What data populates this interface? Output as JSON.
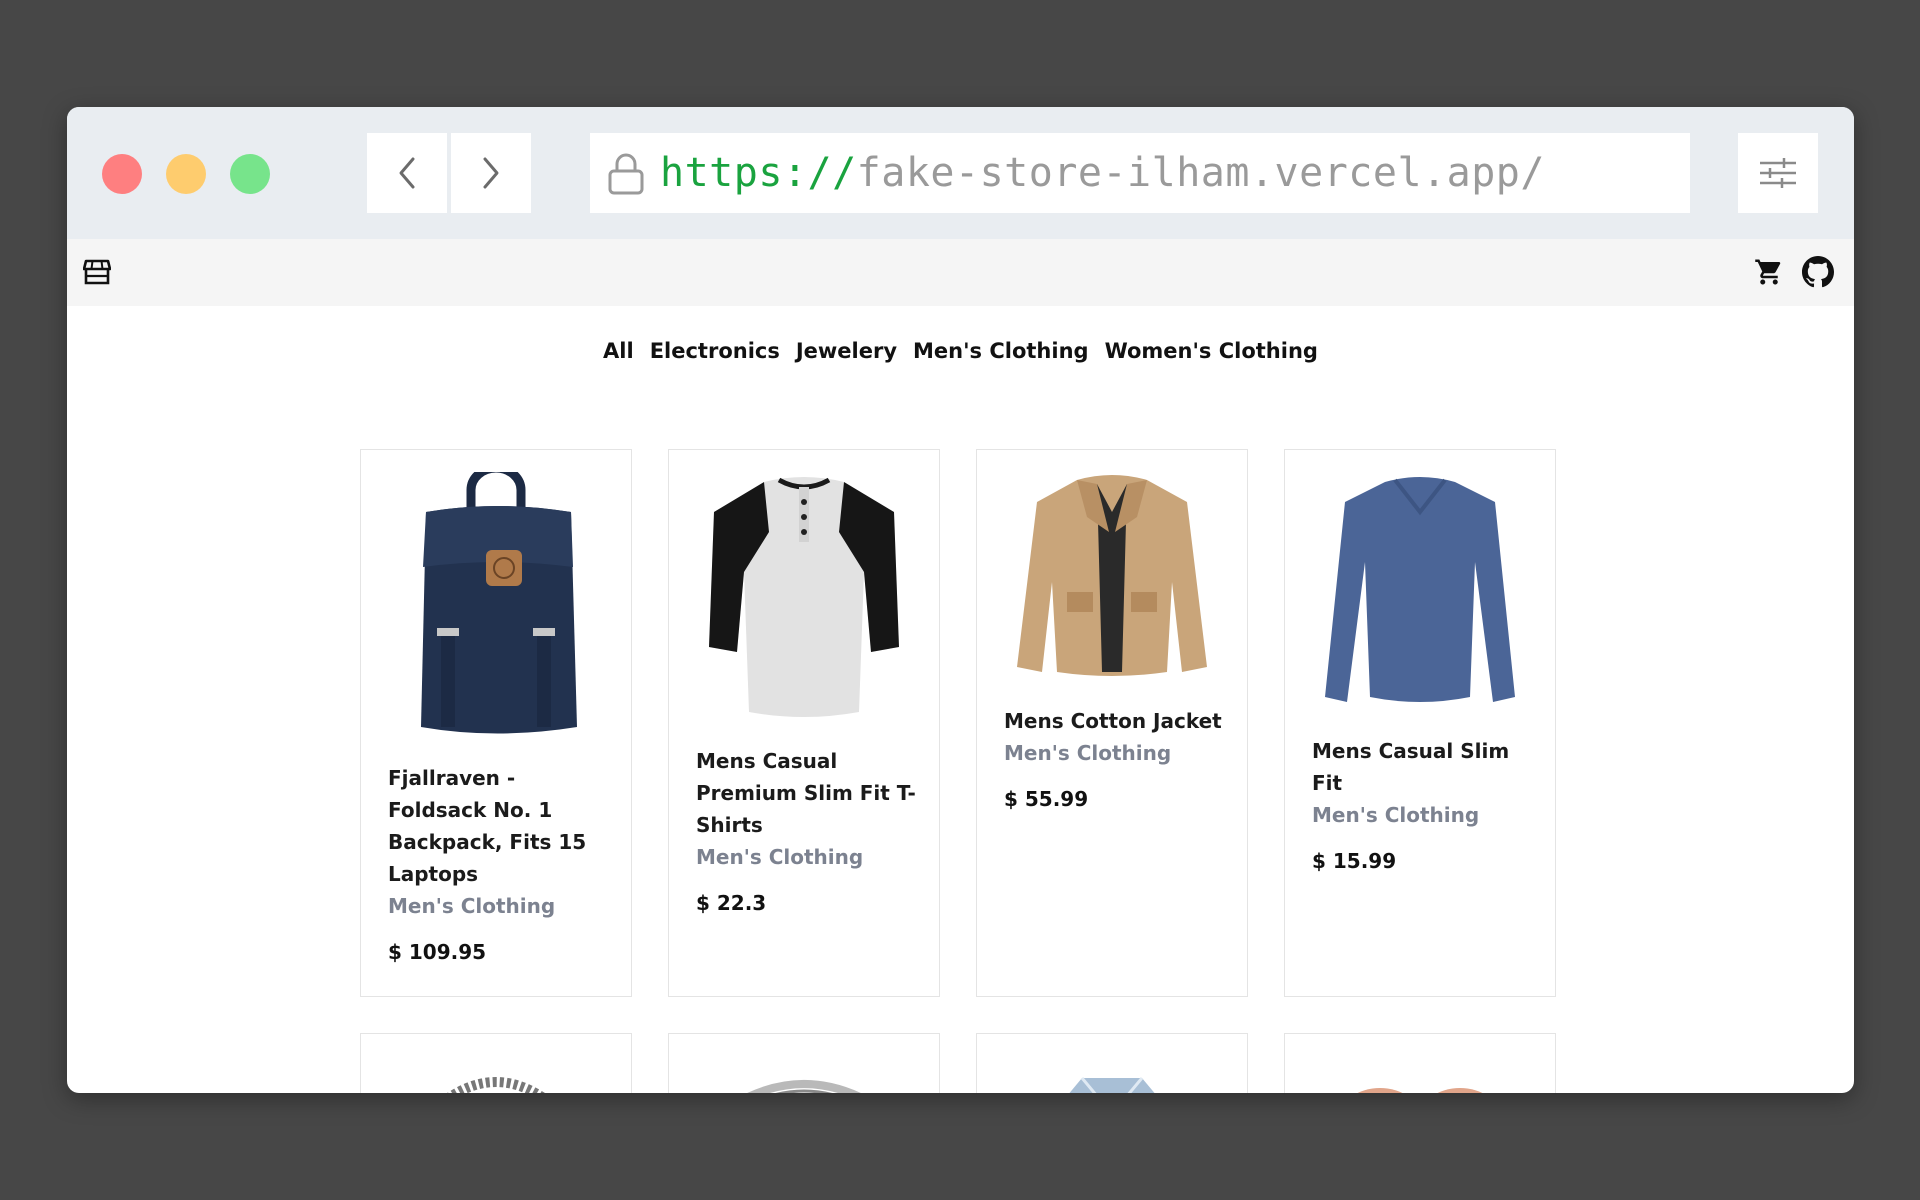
{
  "browser": {
    "url_scheme": "https://",
    "url_host": "fake-store-ilham.vercel.app/"
  },
  "app": {
    "icons": [
      "store-icon",
      "cart-icon",
      "github-icon"
    ]
  },
  "categories": [
    "All",
    "Electronics",
    "Jewelery",
    "Men's Clothing",
    "Women's Clothing"
  ],
  "products": [
    {
      "title": "Fjallraven - Foldsack No. 1 Backpack, Fits 15 Laptops",
      "category": "Men's Clothing",
      "price": "$ 109.95"
    },
    {
      "title": "Mens Casual Premium Slim Fit T-Shirts",
      "category": "Men's Clothing",
      "price": "$ 22.3"
    },
    {
      "title": "Mens Cotton Jacket",
      "category": "Men's Clothing",
      "price": "$ 55.99"
    },
    {
      "title": "Mens Casual Slim Fit",
      "category": "Men's Clothing",
      "price": "$ 15.99"
    }
  ],
  "colors": {
    "page_bg": "#474747",
    "chrome_bg": "#e9edf1",
    "url_scheme": "#1aa33f",
    "category_gray": "#7c8290"
  }
}
